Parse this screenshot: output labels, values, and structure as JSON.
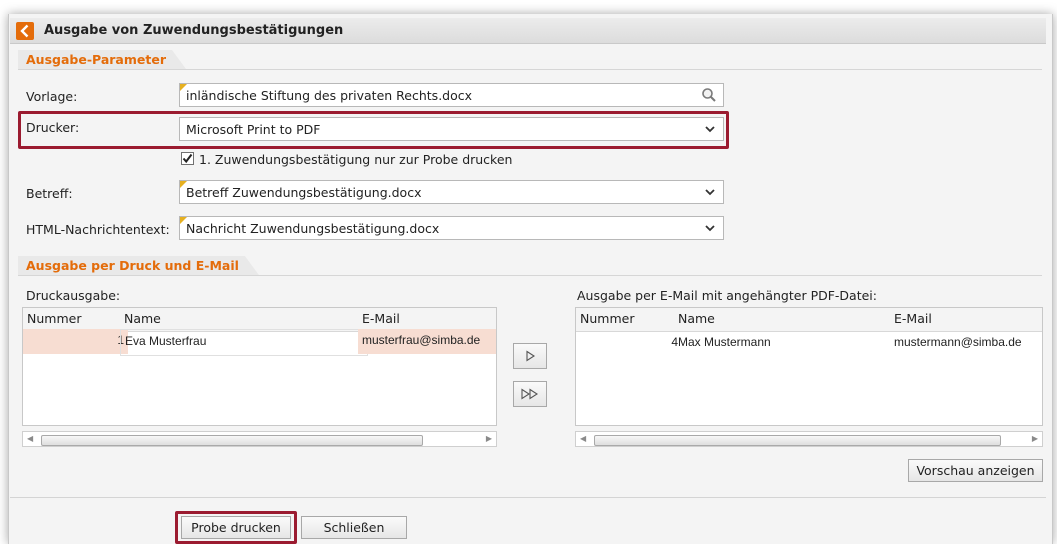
{
  "window": {
    "title": "Ausgabe von Zuwendungsbestätigungen"
  },
  "colors": {
    "accent": "#e46c0a",
    "highlight": "#9b1b30",
    "selected_row": "#f7ddd2"
  },
  "section_params": {
    "title": "Ausgabe-Parameter",
    "vorlage": {
      "label": "Vorlage:",
      "value": "inländische Stiftung des privaten Rechts.docx",
      "icon": "search-icon"
    },
    "drucker": {
      "label": "Drucker:",
      "value": "Microsoft Print to PDF"
    },
    "probe_checkbox": {
      "label": "1. Zuwendungsbestätigung nur zur Probe drucken",
      "checked": true
    },
    "betreff": {
      "label": "Betreff:",
      "value": "Betreff Zuwendungsbestätigung.docx"
    },
    "html_text": {
      "label": "HTML-Nachrichtentext:",
      "value": "Nachricht Zuwendungsbestätigung.docx"
    }
  },
  "section_output": {
    "title": "Ausgabe per Druck und E-Mail",
    "druck": {
      "label": "Druckausgabe:",
      "columns": [
        "Nummer",
        "Name",
        "E-Mail"
      ],
      "rows": [
        {
          "nummer": "1",
          "name": "Eva Musterfrau",
          "email": "musterfrau@simba.de"
        }
      ]
    },
    "email": {
      "label": "Ausgabe per E-Mail mit angehängter PDF-Datei:",
      "columns": [
        "Nummer",
        "Name",
        "E-Mail"
      ],
      "rows": [
        {
          "nummer": "4",
          "name": "Max Mustermann",
          "email": "mustermann@simba.de"
        }
      ]
    },
    "move_one_icon": "triangle-right-icon",
    "move_all_icon": "double-triangle-right-icon",
    "preview_button": "Vorschau anzeigen"
  },
  "footer": {
    "probe_button": "Probe drucken",
    "close_button": "Schließen"
  }
}
